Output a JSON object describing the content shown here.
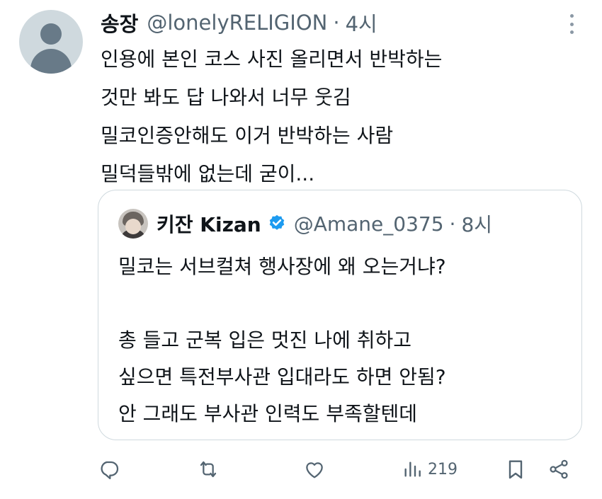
{
  "tweet": {
    "display_name": "송장",
    "handle": "@lonelyRELIGION",
    "separator": "·",
    "time": "4시",
    "lines": [
      "인용에 본인 코스 사진 올리면서 반박하는",
      "것만 봐도 답 나와서 너무 웃김",
      "밀코인증안해도 이거 반박하는 사람",
      "밀덕들밖에 없는데 굳이..."
    ]
  },
  "quote": {
    "display_name": "키잔 Kizan",
    "handle": "@Amane_0375",
    "separator": "·",
    "time": "8시",
    "lines": [
      "밀코는 서브컬쳐 행사장에 왜 오는거냐?",
      "",
      "총 들고 군복 입은 멋진 나에 취하고",
      "싶으면 특전부사관 입대라도 하면 안됨?",
      "안 그래도 부사관 인력도 부족할텐데"
    ]
  },
  "actions": {
    "reply": {
      "icon": "reply-icon"
    },
    "retweet": {
      "icon": "retweet-icon"
    },
    "like": {
      "icon": "heart-icon"
    },
    "views": {
      "icon": "views-icon",
      "count": "219"
    },
    "bookmark": {
      "icon": "bookmark-icon"
    },
    "share": {
      "icon": "share-icon"
    }
  },
  "colors": {
    "text_primary": "#0f1419",
    "text_secondary": "#536471",
    "verified": "#1d9bf0",
    "border": "#cfd9de"
  }
}
